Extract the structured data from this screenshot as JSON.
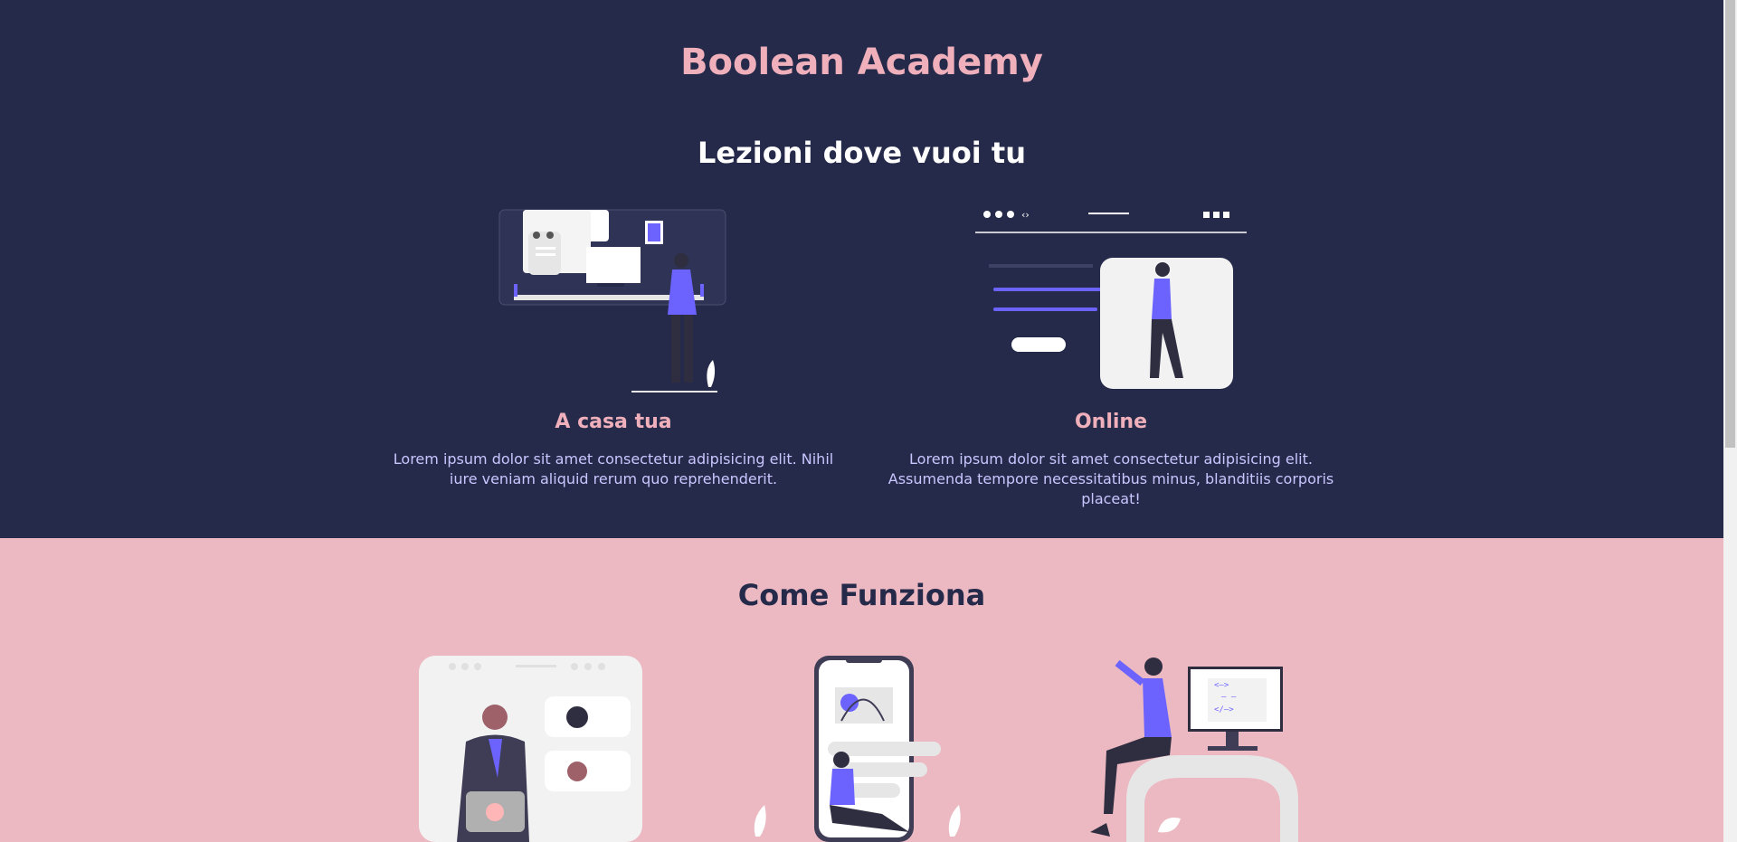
{
  "site": {
    "title": "Boolean Academy"
  },
  "hero": {
    "heading": "Lezioni dove vuoi tu",
    "cards": [
      {
        "title": "A casa tua",
        "text": "Lorem ipsum dolor sit amet consectetur adipisicing elit. Nihil iure veniam aliquid rerum quo reprehenderit.",
        "icon": "home-study-illustration"
      },
      {
        "title": "Online",
        "text": "Lorem ipsum dolor sit amet consectetur adipisicing elit. Assumenda tempore necessitatibus minus, blanditiis corporis placeat!",
        "icon": "online-lesson-illustration"
      }
    ]
  },
  "how": {
    "heading": "Come Funziona",
    "illustrations": [
      "video-call-illustration",
      "mobile-app-illustration",
      "coding-desk-illustration"
    ]
  },
  "colors": {
    "dark": "#262a4a",
    "pink": "#ecb9c2",
    "accent_pink": "#efb0bc",
    "purple": "#6c63ff",
    "light_text": "#c9c6ff"
  }
}
